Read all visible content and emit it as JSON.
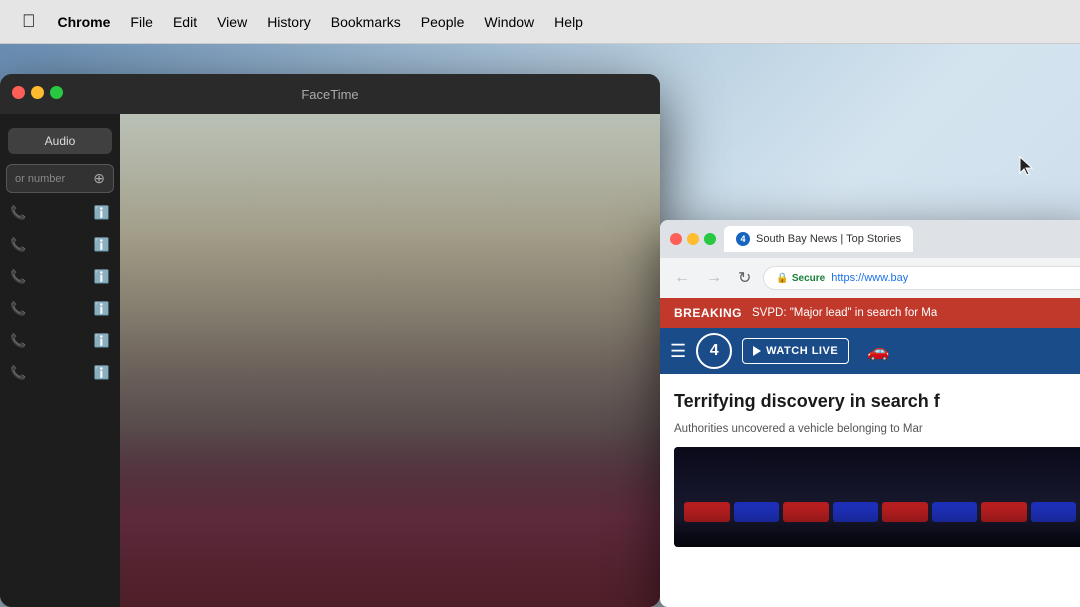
{
  "menubar": {
    "items": [
      {
        "label": "Chrome",
        "id": "chrome",
        "bold": true
      },
      {
        "label": "File",
        "id": "file"
      },
      {
        "label": "Edit",
        "id": "edit"
      },
      {
        "label": "View",
        "id": "view"
      },
      {
        "label": "History",
        "id": "history"
      },
      {
        "label": "Bookmarks",
        "id": "bookmarks"
      },
      {
        "label": "People",
        "id": "people"
      },
      {
        "label": "Window",
        "id": "window"
      },
      {
        "label": "Help",
        "id": "help"
      }
    ]
  },
  "facetime": {
    "title": "FaceTime",
    "sidebar": {
      "audio_button": "Audio",
      "search_placeholder": "or number",
      "contacts": [
        {},
        {},
        {},
        {},
        {},
        {}
      ]
    }
  },
  "chrome": {
    "tab": {
      "title": "South Bay News | Top Stories",
      "icon_label": "4"
    },
    "nav": {
      "back": "←",
      "forward": "→",
      "refresh": "↻"
    },
    "url": {
      "secure_label": "Secure",
      "url_text": "https://www.bay"
    },
    "breaking": {
      "label": "BREAKING",
      "text": "SVPD: \"Major lead\" in search for Ma"
    },
    "nav_bar": {
      "menu_icon": "☰",
      "channel_number": "4",
      "watch_live_label": "WATCH LIVE"
    },
    "article": {
      "headline": "Terrifying discovery in search f",
      "subtext": "Authorities uncovered a vehicle belonging to Mar"
    }
  },
  "colors": {
    "breaking_red": "#c0392b",
    "news_blue": "#1a4c8a",
    "secure_green": "#188038",
    "url_blue": "#1a73e8"
  }
}
